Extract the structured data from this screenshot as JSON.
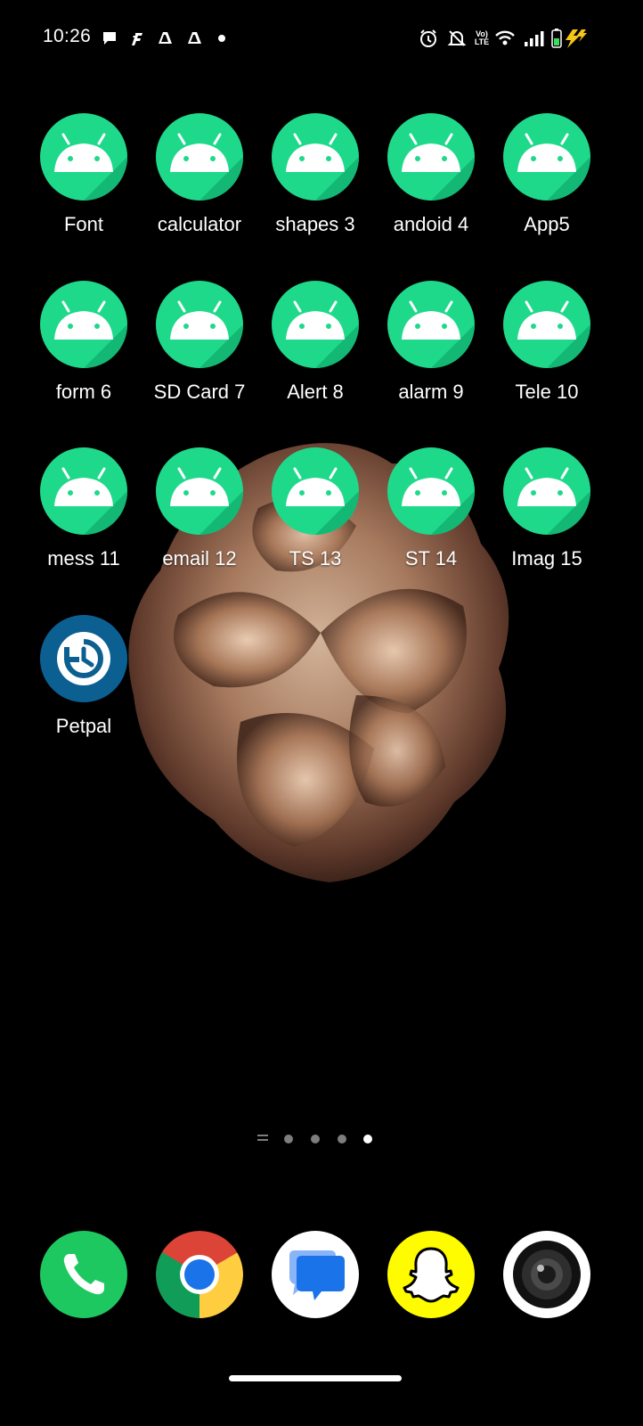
{
  "status_bar": {
    "time": "10:26",
    "network_label": "LTE"
  },
  "home_apps": [
    {
      "label": "Font",
      "icon": "android-icon"
    },
    {
      "label": "calculator",
      "icon": "android-icon"
    },
    {
      "label": "shapes 3",
      "icon": "android-icon"
    },
    {
      "label": "andoid 4",
      "icon": "android-icon"
    },
    {
      "label": "App5",
      "icon": "android-icon"
    },
    {
      "label": "form 6",
      "icon": "android-icon"
    },
    {
      "label": "SD Card 7",
      "icon": "android-icon"
    },
    {
      "label": "Alert 8",
      "icon": "android-icon"
    },
    {
      "label": "alarm 9",
      "icon": "android-icon"
    },
    {
      "label": "Tele 10",
      "icon": "android-icon"
    },
    {
      "label": "mess 11",
      "icon": "android-icon"
    },
    {
      "label": "email 12",
      "icon": "android-icon"
    },
    {
      "label": "TS 13",
      "icon": "android-icon"
    },
    {
      "label": "ST 14",
      "icon": "android-icon"
    },
    {
      "label": "Imag 15",
      "icon": "android-icon"
    },
    {
      "label": "Petpal",
      "icon": "refresh-icon"
    }
  ],
  "page_indicator": {
    "pages": 4,
    "active_index": 3
  },
  "dock": [
    {
      "name": "phone",
      "icon": "phone-icon"
    },
    {
      "name": "chrome",
      "icon": "chrome-icon"
    },
    {
      "name": "messages",
      "icon": "messages-icon"
    },
    {
      "name": "snapchat",
      "icon": "snapchat-icon"
    },
    {
      "name": "camera",
      "icon": "camera-icon"
    }
  ],
  "colors": {
    "android_green": "#1fd98b",
    "petpal_blue": "#0b5f91",
    "phone_green": "#1ec861",
    "snapchat_yellow": "#fffc00"
  }
}
